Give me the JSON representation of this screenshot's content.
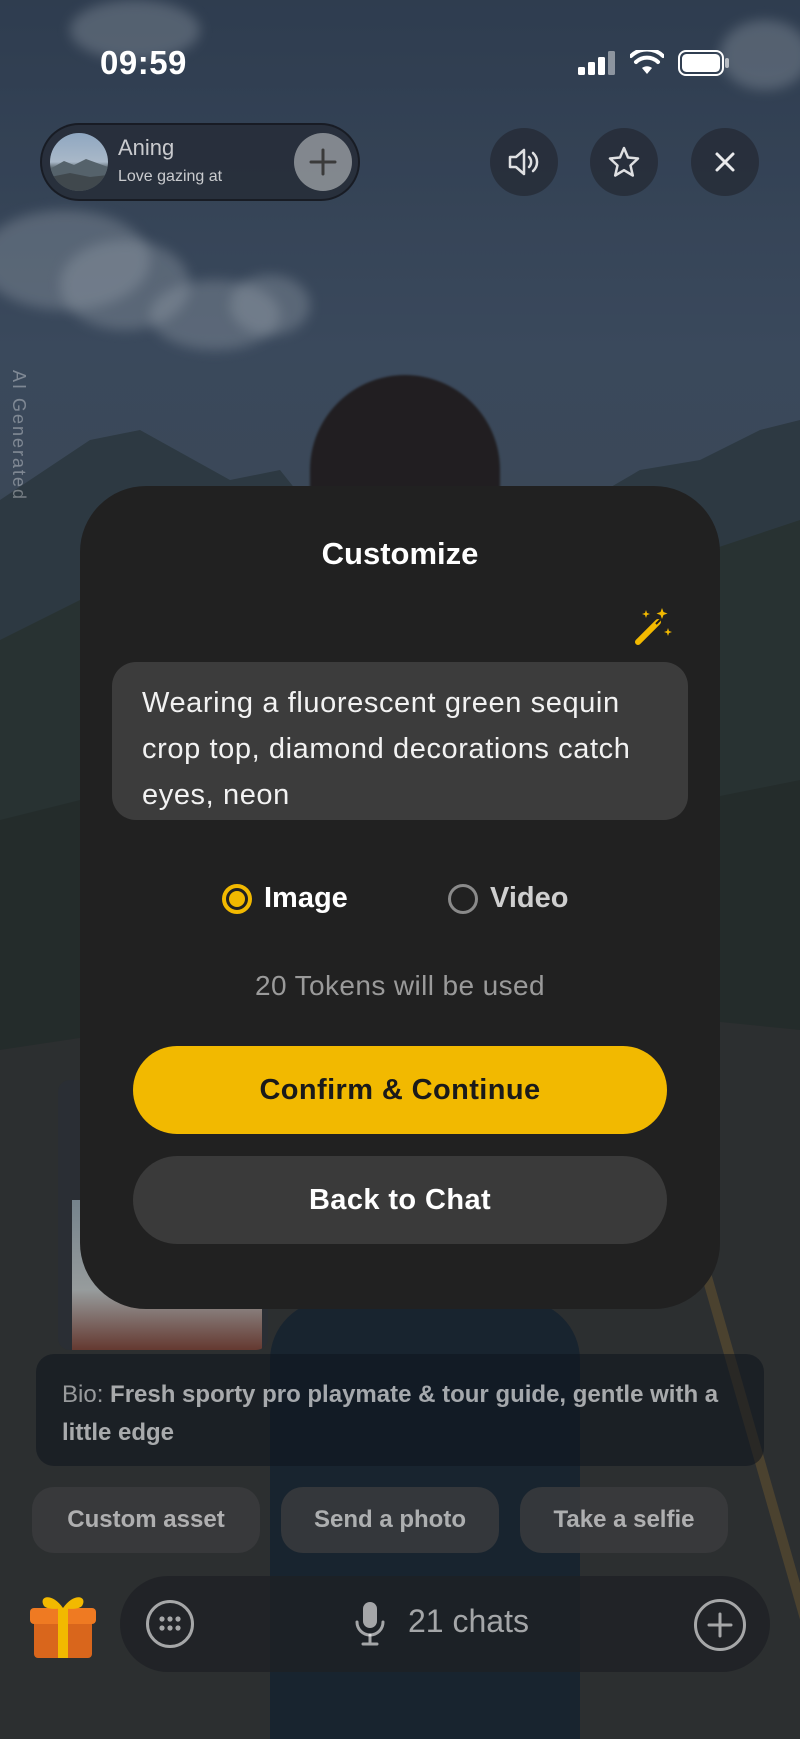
{
  "status_bar": {
    "time": "09:59"
  },
  "header": {
    "profile_name": "Aning",
    "profile_subtitle": "Love gazing at",
    "follow_icon": "plus-icon",
    "sound_icon": "speaker-icon",
    "favorite_icon": "star-icon",
    "close_icon": "close-icon"
  },
  "watermark": "AI Generated",
  "bio": {
    "key": "Bio:",
    "value": "Fresh sporty pro playmate & tour guide, gentle with a little edge"
  },
  "quick_actions": [
    "Custom asset",
    "Send a photo",
    "Take a selfie"
  ],
  "bottom_bar": {
    "chats_label": "21 chats"
  },
  "modal": {
    "title": "Customize",
    "prompt_text": "Wearing a fluorescent green sequin crop top, diamond decorations catch eyes, neon",
    "options": [
      {
        "label": "Image",
        "selected": true
      },
      {
        "label": "Video",
        "selected": false
      }
    ],
    "tokens_text": "20 Tokens will be used",
    "confirm_label": "Confirm & Continue",
    "back_label": "Back to Chat"
  },
  "colors": {
    "accent": "#F2B900",
    "modal_bg": "#212121",
    "input_bg": "#3C3C3C"
  }
}
